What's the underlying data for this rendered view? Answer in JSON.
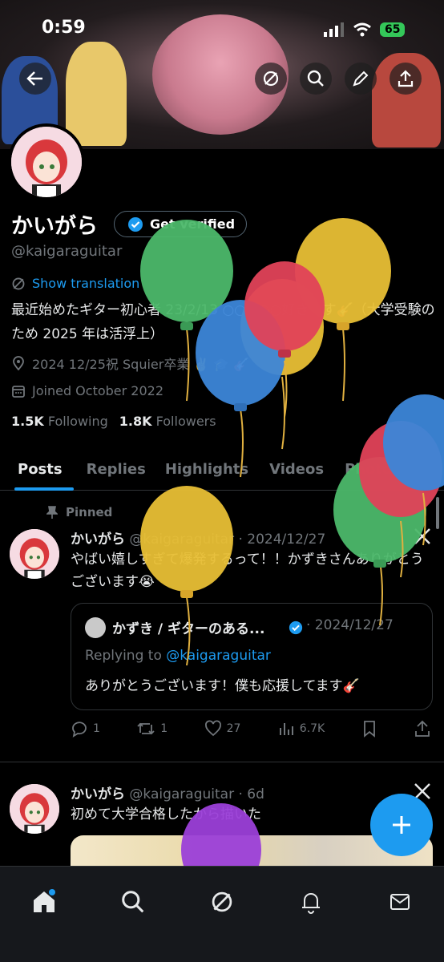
{
  "status": {
    "time": "0:59",
    "battery": "65"
  },
  "profile": {
    "name": "かいがら",
    "verify_label": "Get verified",
    "handle": "@kaigaraguitar",
    "translate_label": "Show translation",
    "bio": "最近始めたギター初心者 23/2/13 ○○○○○好きです🎸（大学受験のため 2025 年は活浮上）",
    "location": "2024 12/25祝 Squier卒業 ✌️ 🎓 🎸",
    "joined": "Joined October 2022",
    "following_count": "1.5K",
    "following_label": "Following",
    "followers_count": "1.8K",
    "followers_label": "Followers"
  },
  "tabs": [
    {
      "label": "Posts"
    },
    {
      "label": "Replies"
    },
    {
      "label": "Highlights"
    },
    {
      "label": "Videos"
    },
    {
      "label": "Photos"
    }
  ],
  "post1": {
    "pinned_label": "Pinned",
    "name": "かいがら",
    "handle": "@kaigaraguitar",
    "date": "· 2024/12/27",
    "text": "やばい嬉しすぎて爆発するって！！かずきさんありがとうございます😭",
    "quote": {
      "name": "かずき / ギターのある...",
      "date": "· 2024/12/27",
      "replying_prefix": "Replying to ",
      "replying_handle": "@kaigaraguitar",
      "text": "ありがとうございます！僕も応援してます🎸"
    },
    "replies": "1",
    "reposts": "1",
    "likes": "27",
    "views": "6.7K"
  },
  "post2": {
    "name": "かいがら",
    "handle": "@kaigaraguitar",
    "date": "· 6d",
    "text": "初めて大学合格したから描いた"
  },
  "colors": {
    "accent": "#1d9bf0",
    "background": "#000000"
  },
  "icons": [
    "back-icon",
    "grok-icon",
    "search-icon",
    "edit-icon",
    "share-icon",
    "home-icon",
    "bell-icon",
    "mail-icon",
    "x-logo-icon",
    "plus-icon"
  ]
}
